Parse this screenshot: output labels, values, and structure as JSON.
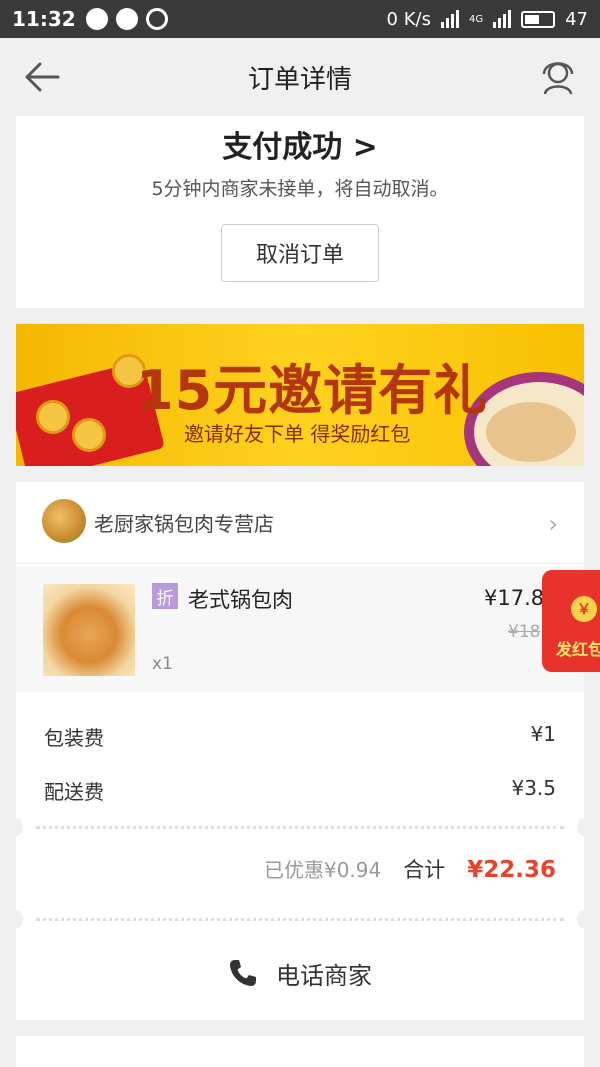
{
  "status_bar": {
    "time": "11:32",
    "net_speed": "0 K/s",
    "signal_tag": "4G",
    "battery": "47"
  },
  "nav": {
    "title": "订单详情"
  },
  "status": {
    "title": "支付成功 >",
    "subtitle": "5分钟内商家未接单，将自动取消。",
    "cancel_label": "取消订单"
  },
  "banner": {
    "title": "15元邀请有礼",
    "subtitle": "邀请好友下单  得奖励红包"
  },
  "order": {
    "shop_name": "老厨家锅包肉专营店",
    "item": {
      "badge": "折",
      "name": "老式锅包肉",
      "qty": "x1",
      "price": "¥17.8",
      "original_price": "¥18"
    },
    "fees": [
      {
        "label": "包装费",
        "value": "¥1"
      },
      {
        "label": "配送费",
        "value": "¥3.5"
      }
    ],
    "discount": "已优惠¥0.94",
    "total_label": "合计",
    "total_value": "¥22.36",
    "call_label": "电话商家"
  },
  "float_red": {
    "coin": "￥",
    "label": "发红包"
  },
  "colors": {
    "accent_red": "#e8442d",
    "badge_purple": "#b89bdc",
    "banner_yellow": "#ffd21f"
  }
}
